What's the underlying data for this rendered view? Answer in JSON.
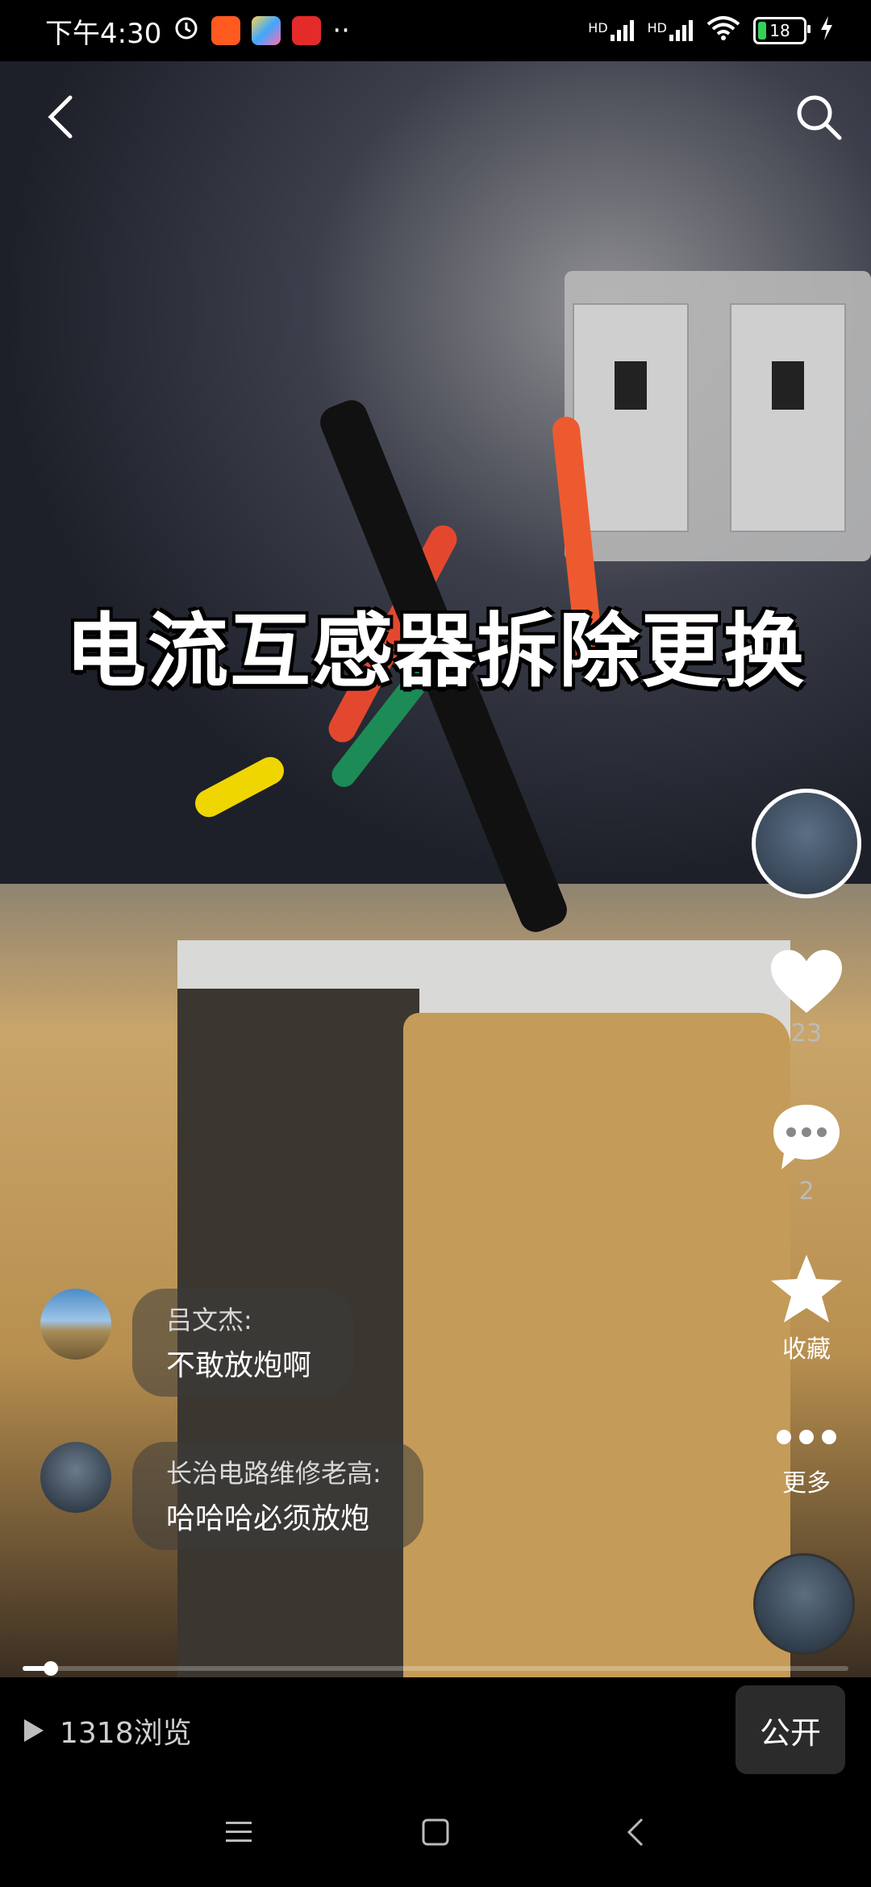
{
  "status_bar": {
    "time": "下午4:30",
    "more_dots": "··",
    "signal_1_label": "HD",
    "signal_2_label": "HD",
    "battery_level": "18"
  },
  "video": {
    "title_overlay": "电流互感器拆除更换",
    "progress_fraction": 0.034
  },
  "actions": {
    "like_count": "23",
    "comment_count": "2",
    "favorite_label": "收藏",
    "more_label": "更多"
  },
  "comments": [
    {
      "name": "吕文杰:",
      "text": "不敢放炮啊"
    },
    {
      "name": "长治电路维修老高:",
      "text": "哈哈哈必须放炮"
    }
  ],
  "footer": {
    "views": "1318浏览",
    "public_label": "公开"
  },
  "colors": {
    "background": "#000000",
    "battery_green": "#35d05a",
    "cabinet_orange": "#c49b58"
  }
}
